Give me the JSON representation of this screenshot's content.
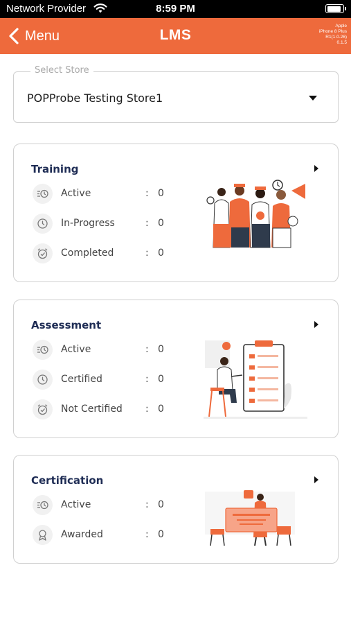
{
  "status_bar": {
    "carrier": "Network Provider",
    "time": "8:59 PM",
    "battery_level": 0.9
  },
  "nav": {
    "back_label": "Menu",
    "title": "LMS",
    "device_info": [
      "Apple",
      "iPhone 8 Plus",
      "R1(1.0.26)",
      "0.1.5"
    ]
  },
  "store": {
    "legend": "Select Store",
    "selected": "POPProbe Testing Store1"
  },
  "colors": {
    "accent": "#ee6a3c",
    "heading": "#1f2d55"
  },
  "training": {
    "title": "Training",
    "rows": [
      {
        "icon": "list-clock-icon",
        "label": "Active",
        "value": "0"
      },
      {
        "icon": "clock-icon",
        "label": "In-Progress",
        "value": "0"
      },
      {
        "icon": "alarm-check-icon",
        "label": "Completed",
        "value": "0"
      }
    ]
  },
  "assessment": {
    "title": "Assessment",
    "rows": [
      {
        "icon": "list-clock-icon",
        "label": "Active",
        "value": "0"
      },
      {
        "icon": "clock-icon",
        "label": "Certified",
        "value": "0"
      },
      {
        "icon": "alarm-check-icon",
        "label": "Not Certified",
        "value": "0"
      }
    ]
  },
  "certification": {
    "title": "Certification",
    "rows": [
      {
        "icon": "list-clock-icon",
        "label": "Active",
        "value": "0"
      },
      {
        "icon": "award-icon",
        "label": "Awarded",
        "value": "0"
      }
    ]
  }
}
